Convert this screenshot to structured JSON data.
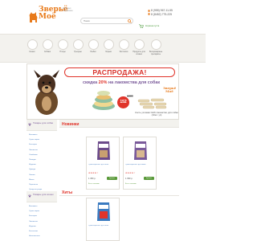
{
  "header": {
    "logo_text": "Зверьё Моё",
    "tagline": "Интернет-зоомагазин",
    "search_placeholder": "Поиск",
    "phones": [
      "8 (955) 967-11-55",
      "8 (8452) 775-225"
    ],
    "cart_text": "Корзина пуста"
  },
  "categories": [
    {
      "label": "Кошки",
      "icon": "cat-icon"
    },
    {
      "label": "Собаки",
      "icon": "dog-icon"
    },
    {
      "label": "Птицы",
      "icon": "bird-icon"
    },
    {
      "label": "Грызуны",
      "icon": "rodent-icon"
    },
    {
      "label": "Рыбки",
      "icon": "fish-icon"
    },
    {
      "label": "Хорьки",
      "icon": "ferret-icon"
    },
    {
      "label": "Рептилии",
      "icon": "reptile-icon"
    },
    {
      "label": "Продукты для хозяев",
      "icon": "owner-icon"
    },
    {
      "label": "Ветеринарные препараты",
      "icon": "vet-icon"
    }
  ],
  "banner": {
    "title": "РАСПРОДАЖА!",
    "subtitle_pre": "скидка ",
    "subtitle_pct": "20%",
    "subtitle_post": " на лакомства для собак",
    "old_price": "190",
    "new_price": "152",
    "logo": "Зверьё Моё",
    "caption": "Кость узловая №16 лакомство для собак (10шт. уп)"
  },
  "sidebar": {
    "title": "Товары для собак",
    "items": [
      "Витамины",
      "Сухие корма",
      "Консервы",
      "Лакомства",
      "Ошейники",
      "Поводки",
      "Игрушки",
      "Одежда",
      "Лежаки",
      "Миски",
      "Переноски",
      "Средства ухода",
      "Аксессуары"
    ]
  },
  "sidebar2": {
    "title": "Товары для кошек",
    "items": [
      "Витамины",
      "Сухие корма",
      "Консервы",
      "Лакомства",
      "Игрушки",
      "Когтеточки",
      "Наполнители"
    ]
  },
  "novelty": {
    "title": "Новинки",
    "products": [
      {
        "name": "Сухой корм Hill's для собак",
        "stars": "★★★★☆",
        "price": "1 450 р.",
        "buy": "Купить",
        "stock": "Есть в наличии"
      },
      {
        "name": "Сухой корм Hill's для кошек",
        "stars": "★★★★☆",
        "price": "1 390 р.",
        "buy": "Купить",
        "stock": "Есть в наличии"
      },
      {
        "name": "Сухой корм Hill's Science Plan",
        "stars": "★★★★☆",
        "price": "1 520 р.",
        "buy": "Купить",
        "stock": "Есть в наличии"
      }
    ]
  },
  "hits": {
    "title": "Хиты",
    "products": [
      {
        "name": "Сухой корм Hill's для собак"
      }
    ]
  },
  "colors": {
    "accent": "#e87a1a",
    "sale": "#e0342a",
    "link": "#4a7fc1",
    "buy": "#5a9a3a"
  }
}
